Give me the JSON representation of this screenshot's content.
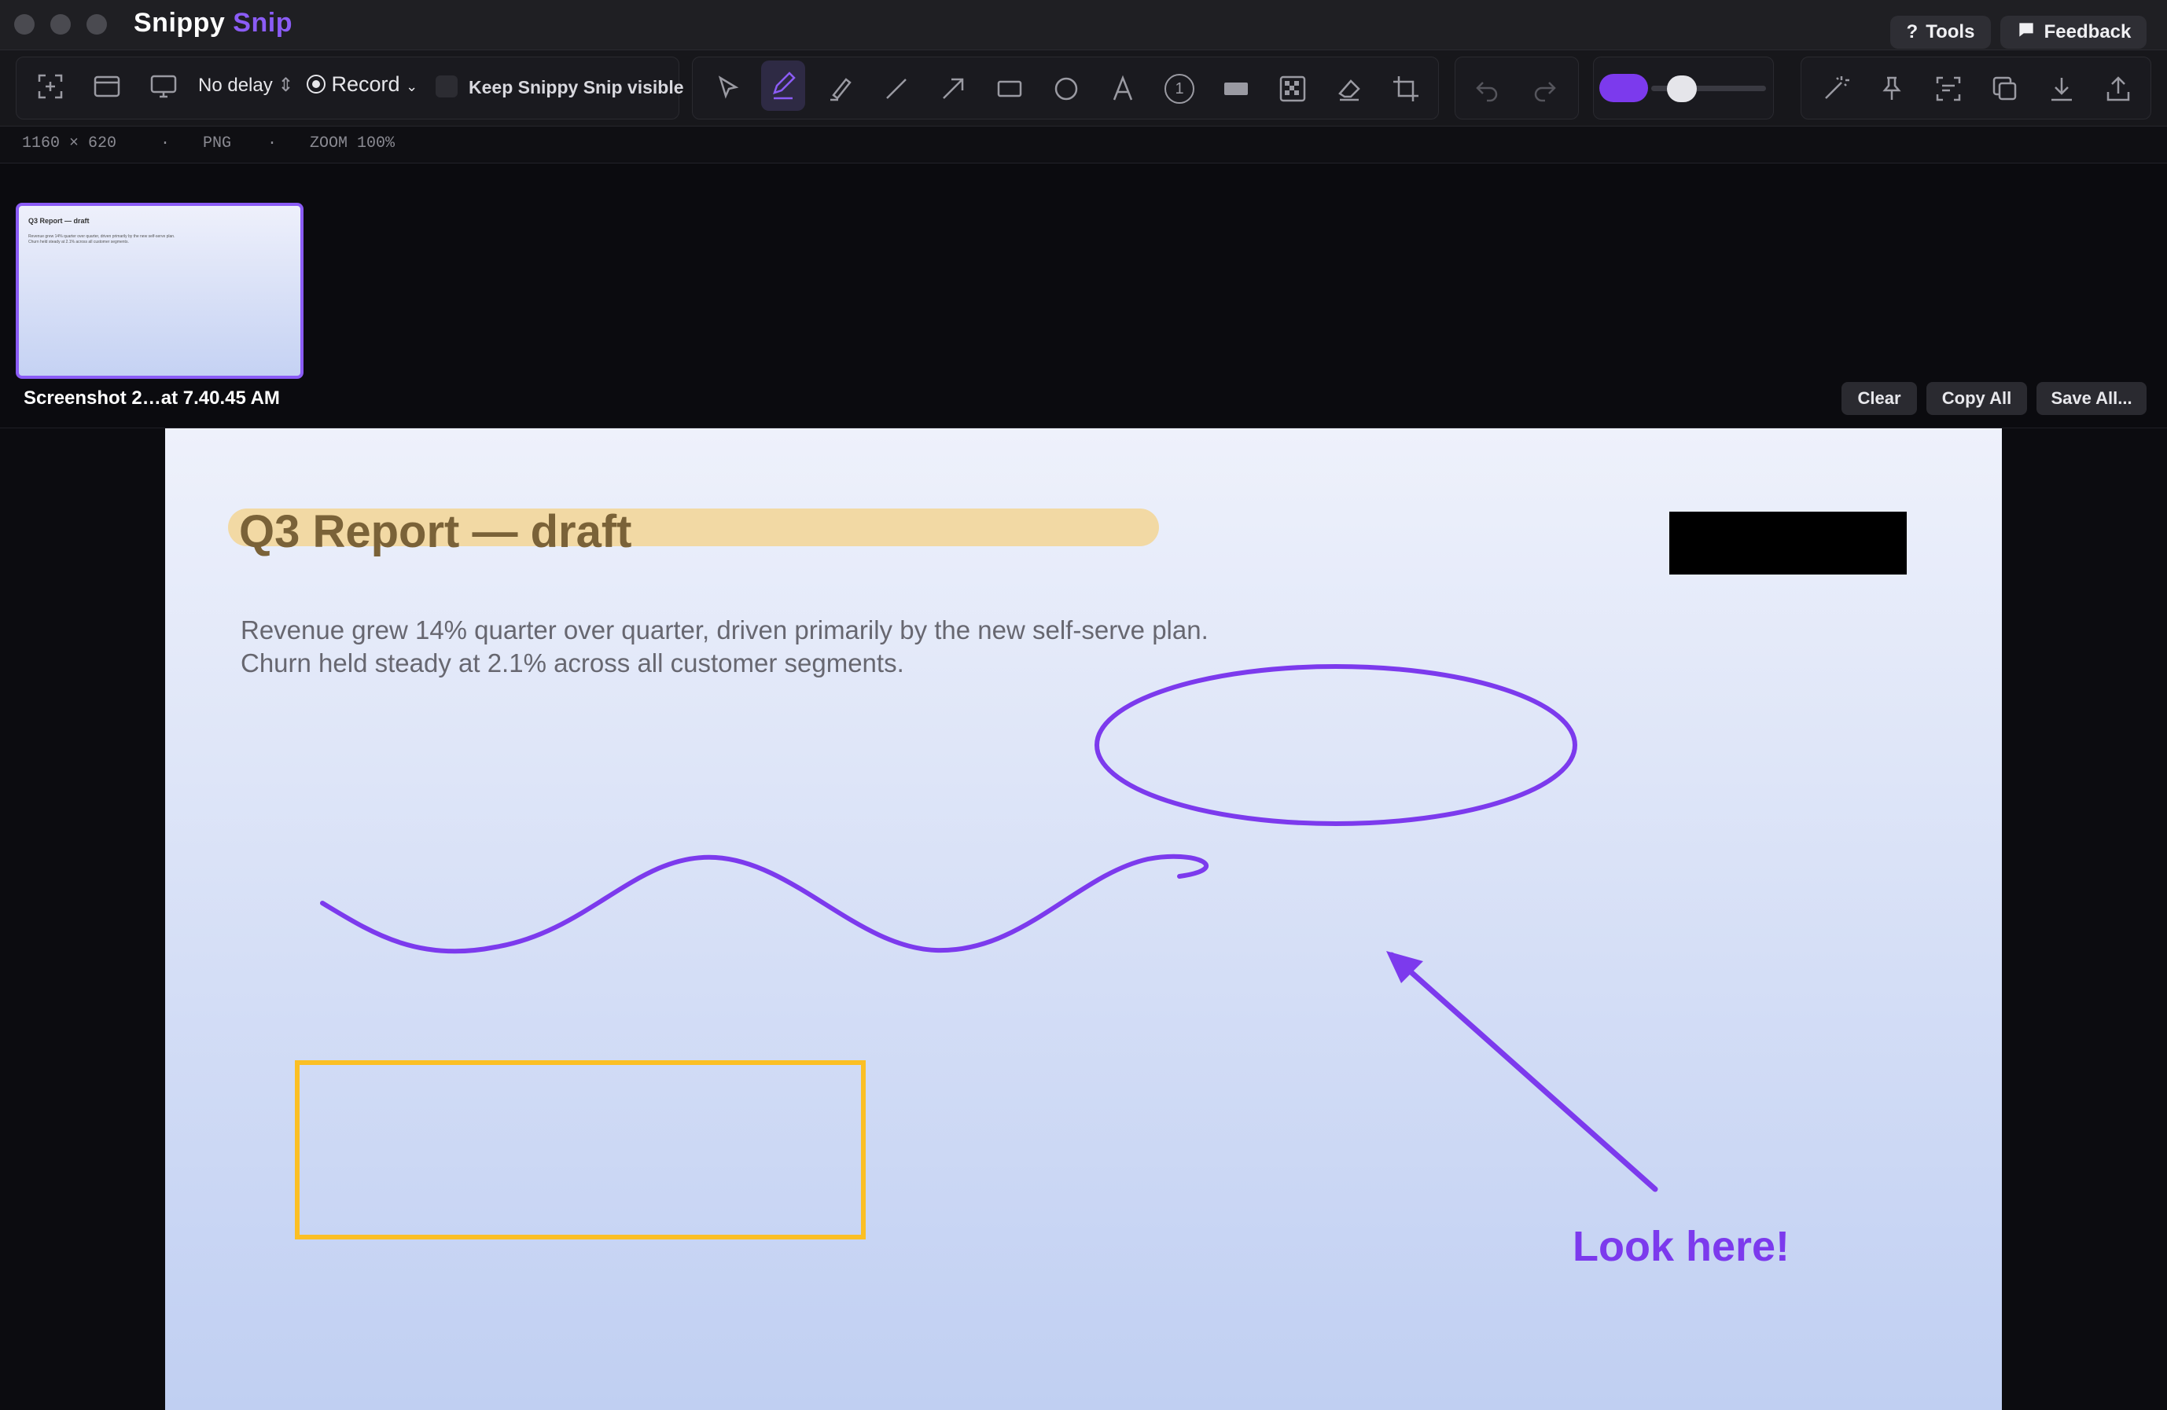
{
  "app": {
    "name_part1": "Snippy",
    "name_part2": "Snip",
    "tools_label": "Tools",
    "tools_glyph": "?",
    "feedback_label": "Feedback"
  },
  "toolbar": {
    "delay_value": "No delay",
    "record_label": "Record",
    "keep_visible_label": "Keep Snippy Snip visible",
    "keep_visible_checked": false,
    "accent_color": "#7c3aed",
    "active_tool": "pen",
    "capture_icons": [
      "capture-region-icon",
      "capture-window-icon",
      "capture-screen-icon"
    ],
    "draw_tools": [
      "select-tool-icon",
      "pen-tool-icon",
      "highlighter-tool-icon",
      "line-tool-icon",
      "arrow-tool-icon",
      "rectangle-tool-icon",
      "ellipse-tool-icon",
      "text-tool-icon",
      "counter-tool-icon",
      "redact-tool-icon",
      "pixelate-tool-icon",
      "eraser-tool-icon",
      "crop-tool-icon"
    ],
    "history_icons": [
      "undo-icon",
      "redo-icon"
    ],
    "action_icons": [
      "magic-wand-icon",
      "pin-icon",
      "scan-icon",
      "duplicate-icon",
      "download-icon",
      "share-icon"
    ],
    "counter_glyph": "1"
  },
  "status": {
    "dimensions": "1160 × 620",
    "sep1": "·",
    "format": "PNG",
    "sep2": "·",
    "zoom": "ZOOM 100%"
  },
  "thumbnails": [
    {
      "caption": "Screenshot 2…at 7.40.45 AM",
      "preview_title": "Q3 Report — draft",
      "preview_body": "Revenue grew 14% quarter over quarter, driven primarily by the new self-serve plan. Churn held steady at 2.1% across all customer segments."
    }
  ],
  "strip_actions": {
    "clear": "Clear",
    "copy_all": "Copy All",
    "save_all": "Save All..."
  },
  "document": {
    "title": "Q3 Report — draft",
    "body": "Revenue grew 14% quarter over quarter, driven primarily by the new self-serve plan. Churn held steady at 2.1% across all customer segments."
  },
  "annotations": {
    "callout_text": "Look here!",
    "stroke_color": "#7c3aed",
    "rect_color": "#fbbf24",
    "highlight_color": "#f2d9a4",
    "redact_color": "#000000"
  }
}
